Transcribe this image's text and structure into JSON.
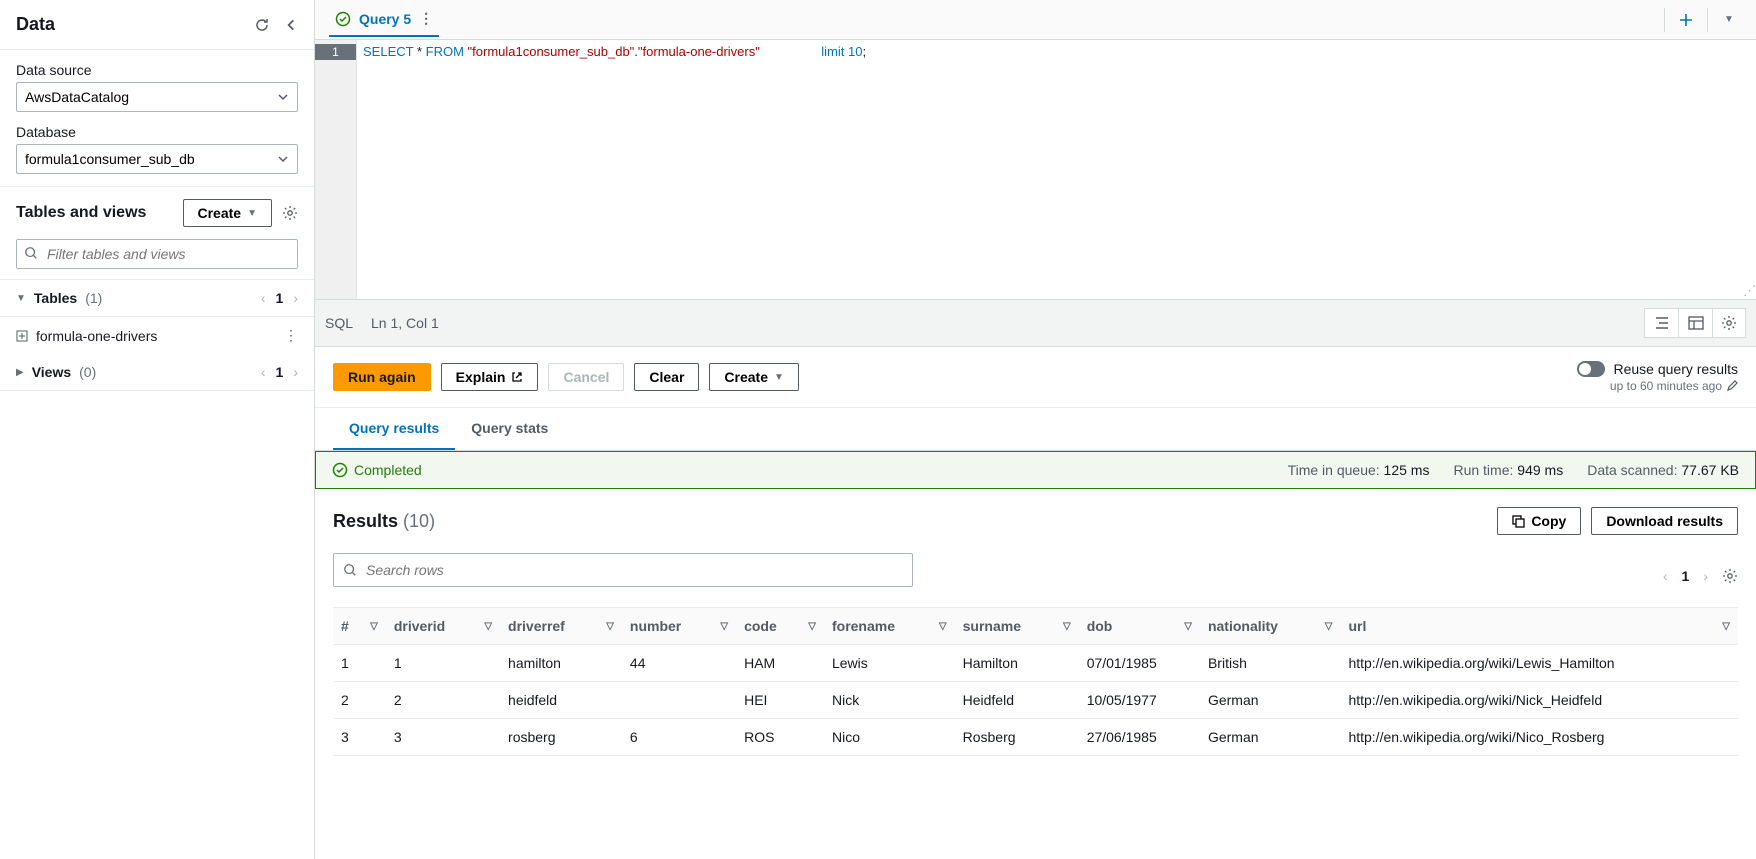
{
  "sidebar": {
    "title": "Data",
    "data_source_label": "Data source",
    "data_source_value": "AwsDataCatalog",
    "database_label": "Database",
    "database_value": "formula1consumer_sub_db",
    "tv_title": "Tables and views",
    "create_label": "Create",
    "filter_placeholder": "Filter tables and views",
    "tables_label": "Tables",
    "tables_count": "(1)",
    "tables_page": "1",
    "table_item": "formula-one-drivers",
    "views_label": "Views",
    "views_count": "(0)",
    "views_page": "1"
  },
  "tab": {
    "name": "Query 5"
  },
  "editor": {
    "line": "1",
    "sql_select": "SELECT",
    "sql_star": " * ",
    "sql_from": "FROM ",
    "sql_s1": "\"formula1consumer_sub_db\"",
    "sql_dot": ".",
    "sql_s2": "\"formula-one-drivers\"",
    "sql_limit": " limit ",
    "sql_num": "10",
    "sql_semi": ";"
  },
  "status": {
    "lang": "SQL",
    "pos": "Ln 1, Col 1"
  },
  "actions": {
    "run": "Run again",
    "explain": "Explain",
    "cancel": "Cancel",
    "clear": "Clear",
    "create": "Create",
    "reuse_label": "Reuse query results",
    "reuse_sub": "up to 60 minutes ago"
  },
  "rtabs": {
    "results": "Query results",
    "stats": "Query stats"
  },
  "strip": {
    "completed": "Completed",
    "tq_l": "Time in queue:",
    "tq_v": "125 ms",
    "rt_l": "Run time:",
    "rt_v": "949 ms",
    "ds_l": "Data scanned:",
    "ds_v": "77.67 KB"
  },
  "results": {
    "title": "Results",
    "count": "(10)",
    "copy": "Copy",
    "download": "Download results",
    "search_placeholder": "Search rows",
    "page": "1",
    "cols": [
      "#",
      "driverid",
      "driverref",
      "number",
      "code",
      "forename",
      "surname",
      "dob",
      "nationality",
      "url"
    ],
    "rows": [
      {
        "c": [
          "1",
          "1",
          "hamilton",
          "44",
          "HAM",
          "Lewis",
          "Hamilton",
          "07/01/1985",
          "British",
          "http://en.wikipedia.org/wiki/Lewis_Hamilton"
        ]
      },
      {
        "c": [
          "2",
          "2",
          "heidfeld",
          "",
          "HEI",
          "Nick",
          "Heidfeld",
          "10/05/1977",
          "German",
          "http://en.wikipedia.org/wiki/Nick_Heidfeld"
        ]
      },
      {
        "c": [
          "3",
          "3",
          "rosberg",
          "6",
          "ROS",
          "Nico",
          "Rosberg",
          "27/06/1985",
          "German",
          "http://en.wikipedia.org/wiki/Nico_Rosberg"
        ]
      }
    ]
  }
}
